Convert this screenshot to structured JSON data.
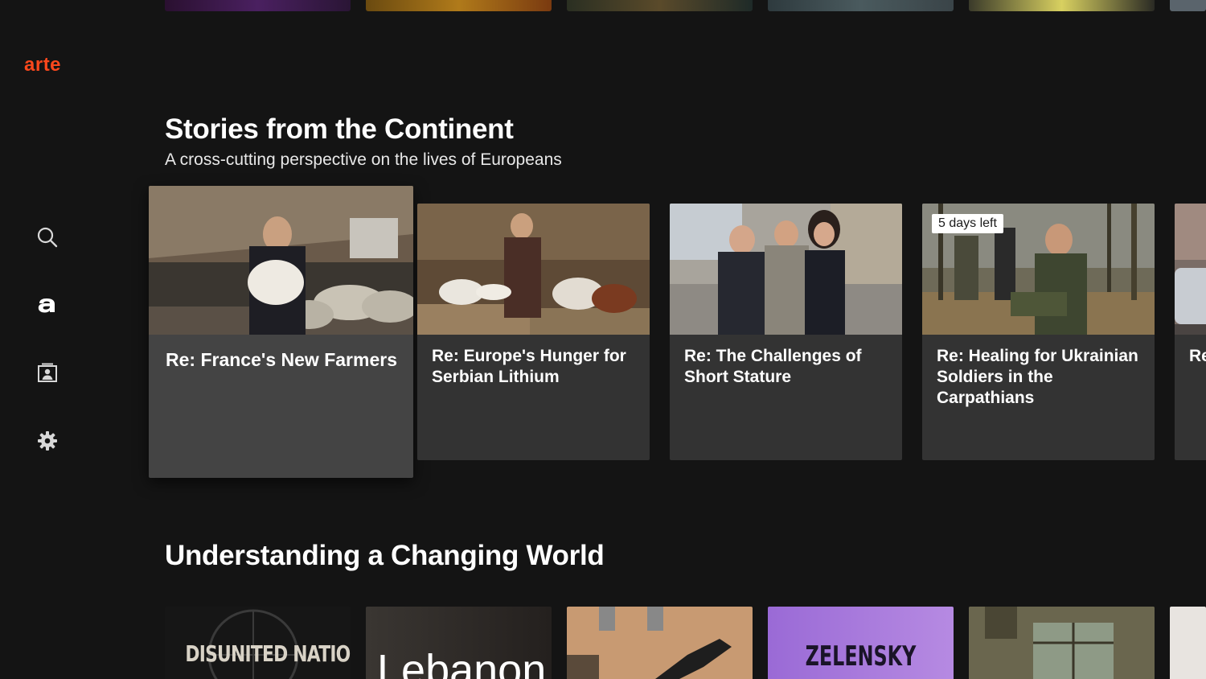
{
  "brand": {
    "logo_text": "arte",
    "accent_color": "#fa481c"
  },
  "nav": [
    {
      "id": "search",
      "icon": "search-icon"
    },
    {
      "id": "home",
      "icon": "arte-a-icon"
    },
    {
      "id": "my-list",
      "icon": "profile-list-icon"
    },
    {
      "id": "settings",
      "icon": "gear-icon"
    }
  ],
  "section_stories": {
    "title": "Stories from the Continent",
    "subtitle": "A cross-cutting perspective on the lives of Europeans",
    "cards": [
      {
        "title": "Re: France's New Farmers",
        "focused": true
      },
      {
        "title": "Re: Europe's Hunger for Serbian Lithium"
      },
      {
        "title": "Re: The Challenges of Short Stature"
      },
      {
        "title": "Re: Healing for Ukrainian Soldiers in the Carpathians",
        "badge": "5 days left"
      },
      {
        "title": "Re: Hu"
      }
    ]
  },
  "section_world": {
    "title": "Understanding a Changing World",
    "thumbs": [
      {
        "text": "DISUNITED NATIONS"
      },
      {
        "text": "Lebanon"
      },
      {
        "text": ""
      },
      {
        "text": "ZELENSKY"
      },
      {
        "text": ""
      }
    ]
  }
}
